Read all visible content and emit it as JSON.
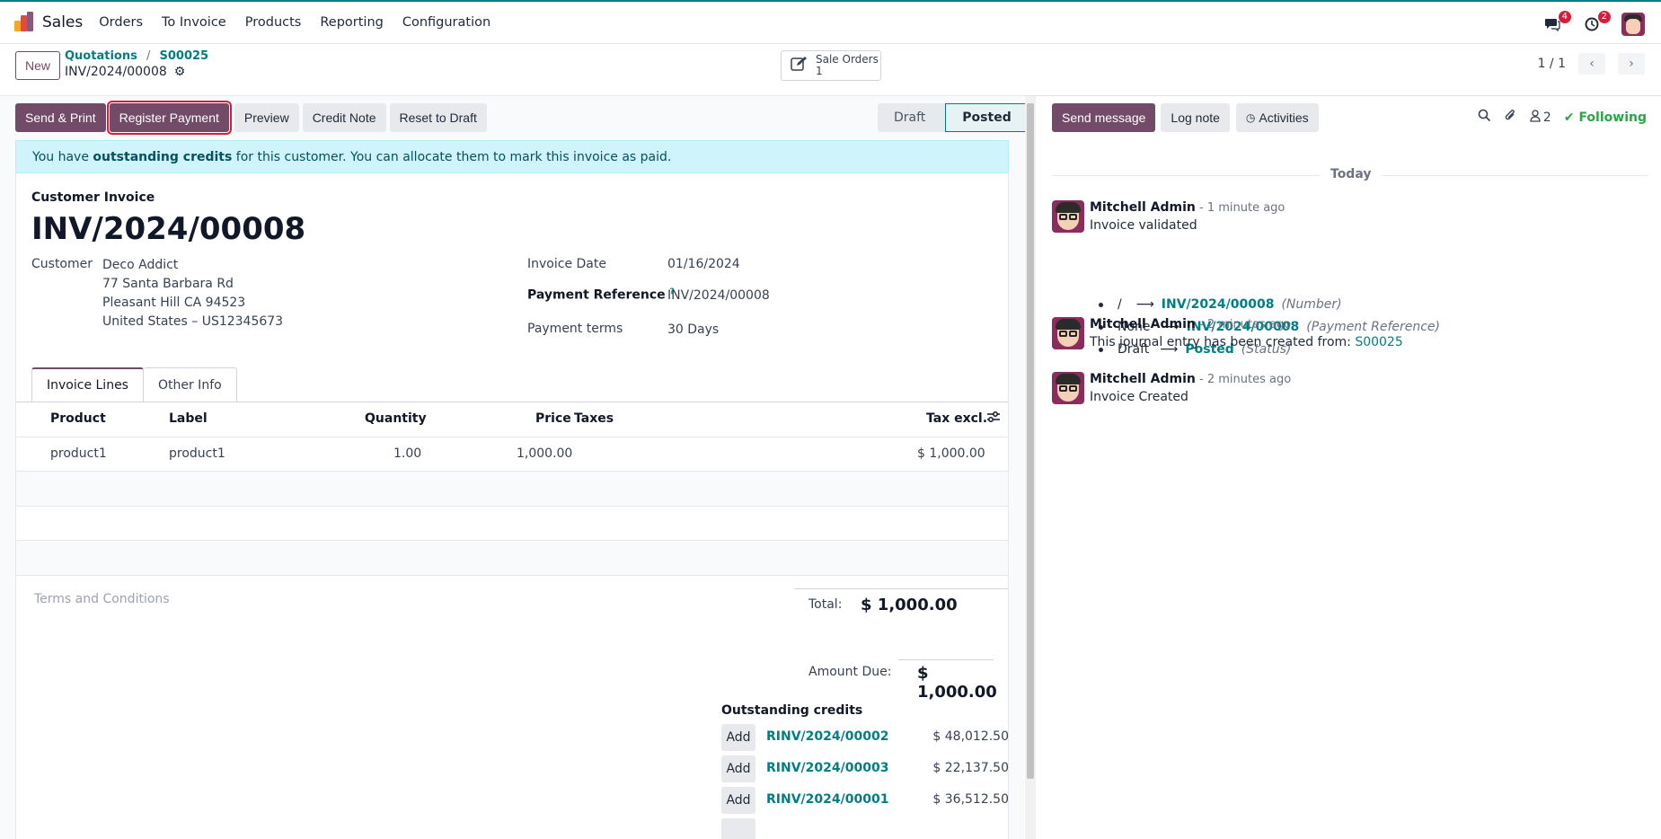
{
  "nav": {
    "app_name": "Sales",
    "menu": [
      "Orders",
      "To Invoice",
      "Products",
      "Reporting",
      "Configuration"
    ],
    "messages_badge": "4",
    "activities_badge": "2"
  },
  "control": {
    "new_label": "New",
    "breadcrumb_1": "Quotations",
    "breadcrumb_sep": "/",
    "breadcrumb_2": "S00025",
    "record_name": "INV/2024/00008",
    "smart_button_label": "Sale Orders",
    "smart_button_count": "1",
    "pager_value": "1 / 1"
  },
  "actions": {
    "send_print": "Send & Print",
    "register_payment": "Register Payment",
    "preview": "Preview",
    "credit_note": "Credit Note",
    "reset_to_draft": "Reset to Draft"
  },
  "status": {
    "draft": "Draft",
    "posted": "Posted",
    "current": "Posted"
  },
  "alert": {
    "prefix": "You have ",
    "bold": "outstanding credits",
    "suffix": " for this customer. You can allocate them to mark this invoice as paid."
  },
  "invoice": {
    "type": "Customer Invoice",
    "name": "INV/2024/00008",
    "customer_label": "Customer",
    "customer_name": "Deco Addict",
    "address_1": "77 Santa Barbara Rd",
    "address_2": "Pleasant Hill CA 94523",
    "address_3": "United States – US12345673",
    "invoice_date_label": "Invoice Date",
    "invoice_date": "01/16/2024",
    "payment_ref_label": "Payment Reference",
    "payment_ref_help": "?",
    "payment_ref": "INV/2024/00008",
    "payment_terms_label": "Payment terms",
    "payment_terms": "30 Days"
  },
  "tabs": [
    "Invoice Lines",
    "Other Info"
  ],
  "lines": {
    "headers": {
      "product": "Product",
      "label": "Label",
      "quantity": "Quantity",
      "price": "Price",
      "taxes": "Taxes",
      "tax_excl": "Tax excl."
    },
    "rows": [
      {
        "product": "product1",
        "label": "product1",
        "quantity": "1.00",
        "price": "1,000.00",
        "taxes": "",
        "tax_excl": "$ 1,000.00"
      }
    ]
  },
  "terms_placeholder": "Terms and Conditions",
  "totals": {
    "total_label": "Total:",
    "total_value": "$ 1,000.00",
    "amount_due_label": "Amount Due:",
    "amount_due_value": "$ 1,000.00"
  },
  "outstanding": {
    "title": "Outstanding credits",
    "add_label": "Add",
    "items": [
      {
        "ref": "RINV/2024/00002",
        "amount": "$ 48,012.50"
      },
      {
        "ref": "RINV/2024/00003",
        "amount": "$ 22,137.50"
      },
      {
        "ref": "RINV/2024/00001",
        "amount": "$ 36,512.50"
      }
    ]
  },
  "chatter": {
    "send_message": "Send message",
    "log_note": "Log note",
    "activities": "Activities",
    "followers_count": "2",
    "following": "Following",
    "date_separator": "Today",
    "messages": [
      {
        "author": "Mitchell Admin",
        "time": " - 1 minute ago",
        "body": "Invoice validated",
        "tracking": [
          {
            "old": "/",
            "new": "INV/2024/00008",
            "field": "(Number)"
          },
          {
            "old": "None",
            "new": "INV/2024/00008",
            "field": "(Payment Reference)"
          },
          {
            "old": "Draft",
            "new": "Posted",
            "field": "(Status)"
          }
        ]
      },
      {
        "author": "Mitchell Admin",
        "time": " - 2 minutes ago",
        "body": "This journal entry has been created from: ",
        "link": "S00025"
      },
      {
        "author": "Mitchell Admin",
        "time": " - 2 minutes ago",
        "body": "Invoice Created"
      }
    ]
  },
  "colors": {
    "brand": "#714b67",
    "link": "#017e84",
    "highlight": "#d61e3c",
    "alert_bg": "#cff4fc"
  }
}
